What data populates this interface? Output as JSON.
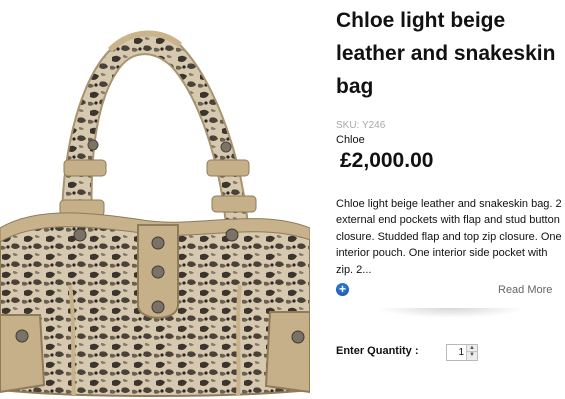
{
  "product": {
    "title": "Chloe light beige leather and snakeskin bag",
    "sku": "SKU: Y246",
    "brand": "Chloe",
    "price": "£2,000.00",
    "description": "Chloe light beige leather and snakeskin bag. 2 external end pockets with flap and stud button closure. Studded flap and top zip closure. One interior pouch. One interior side pocket with zip. 2...",
    "image_alt": "Chloe light beige leather and snakeskin bag"
  },
  "actions": {
    "expand_icon": "plus-circle-icon",
    "read_more": "Read More"
  },
  "quantity": {
    "label": "Enter Quantity :",
    "value": "1",
    "up_icon": "spinner-up-icon",
    "down_icon": "spinner-down-icon"
  },
  "colors": {
    "accent": "#2a72d8",
    "leather": "#c4b08a",
    "snake_dark": "#3a352e",
    "snake_light": "#d8ccb4"
  }
}
